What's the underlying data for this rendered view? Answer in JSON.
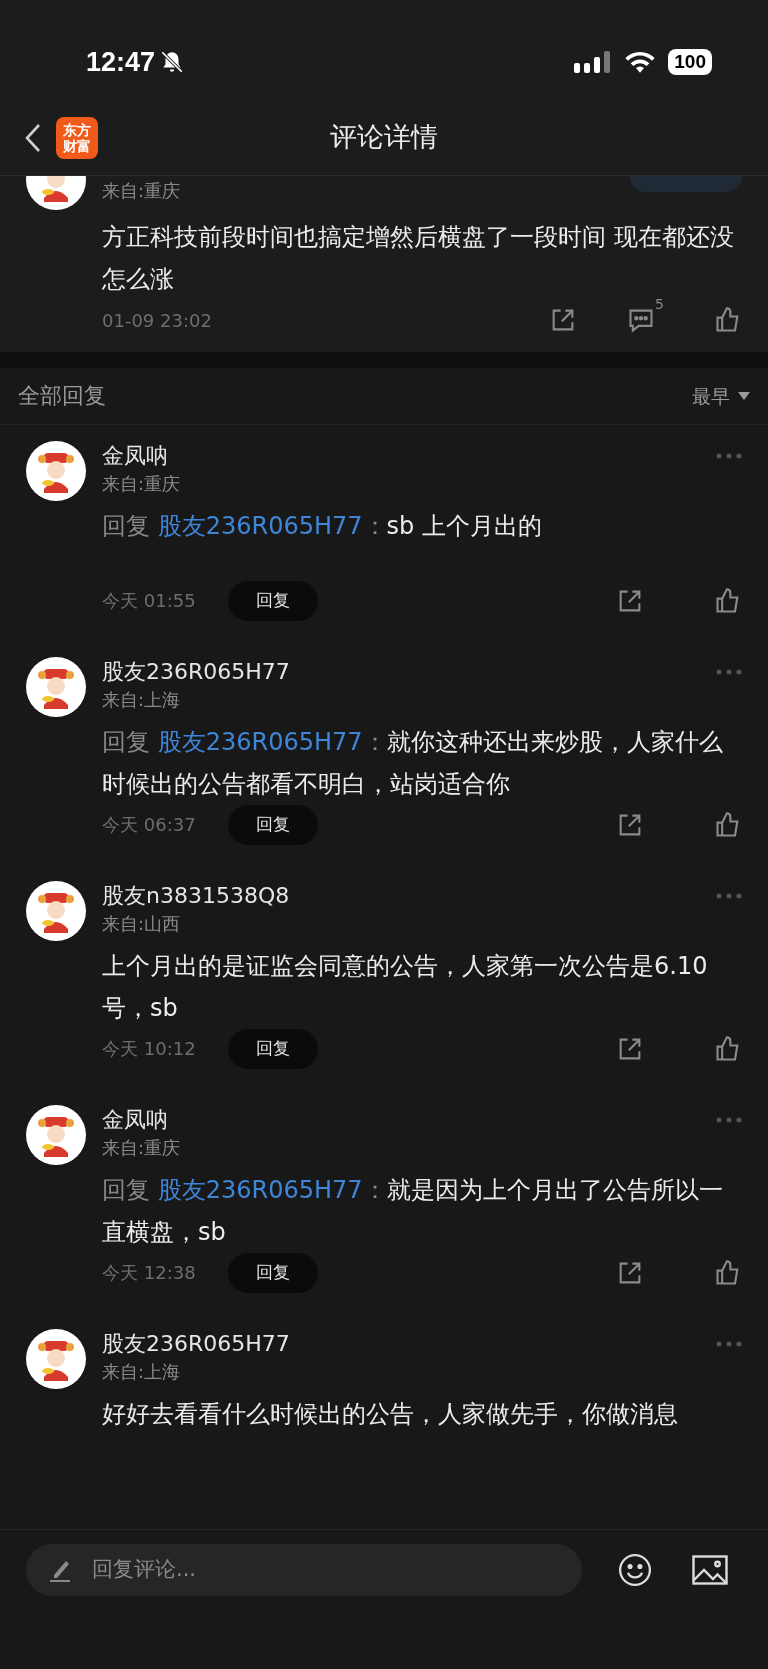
{
  "status_bar": {
    "time": "12:47",
    "battery": "100"
  },
  "header": {
    "title": "评论详情",
    "logo_line1": "东方",
    "logo_line2": "财富"
  },
  "main_comment": {
    "location": "来自:重庆",
    "text": "方正科技前段时间也搞定增然后横盘了一段时间 现在都还没怎么涨",
    "time": "01-09 23:02",
    "reply_count": "5"
  },
  "replies_header": {
    "title": "全部回复",
    "sort": "最早"
  },
  "replies": [
    {
      "kind": "reply",
      "author": "金凤呐",
      "location": "来自:重庆",
      "reply_label": "回复",
      "reply_to": "股友236R065H77",
      "separator": "：",
      "text": "sb 上个月出的",
      "time": "今天 01:55",
      "reply_button": "回复"
    },
    {
      "kind": "reply",
      "author": "股友236R065H77",
      "location": "来自:上海",
      "reply_label": "回复",
      "reply_to": "股友236R065H77",
      "separator": "：",
      "text": "就你这种还出来炒股，人家什么时候出的公告都看不明白，站岗适合你",
      "time": "今天 06:37",
      "reply_button": "回复"
    },
    {
      "kind": "plain",
      "author": "股友n3831538Q8",
      "location": "来自:山西",
      "text": "上个月出的是证监会同意的公告，人家第一次公告是6.10号，sb",
      "time": "今天 10:12",
      "reply_button": "回复"
    },
    {
      "kind": "reply",
      "author": "金凤呐",
      "location": "来自:重庆",
      "reply_label": "回复",
      "reply_to": "股友236R065H77",
      "separator": "：",
      "text": "就是因为上个月出了公告所以一直横盘，sb",
      "time": "今天 12:38",
      "reply_button": "回复"
    },
    {
      "kind": "plain",
      "author": "股友236R065H77",
      "location": "来自:上海",
      "text": "好好去看看什么时候出的公告，人家做先手，你做消息"
    }
  ],
  "bottom_bar": {
    "placeholder": "回复评论..."
  }
}
